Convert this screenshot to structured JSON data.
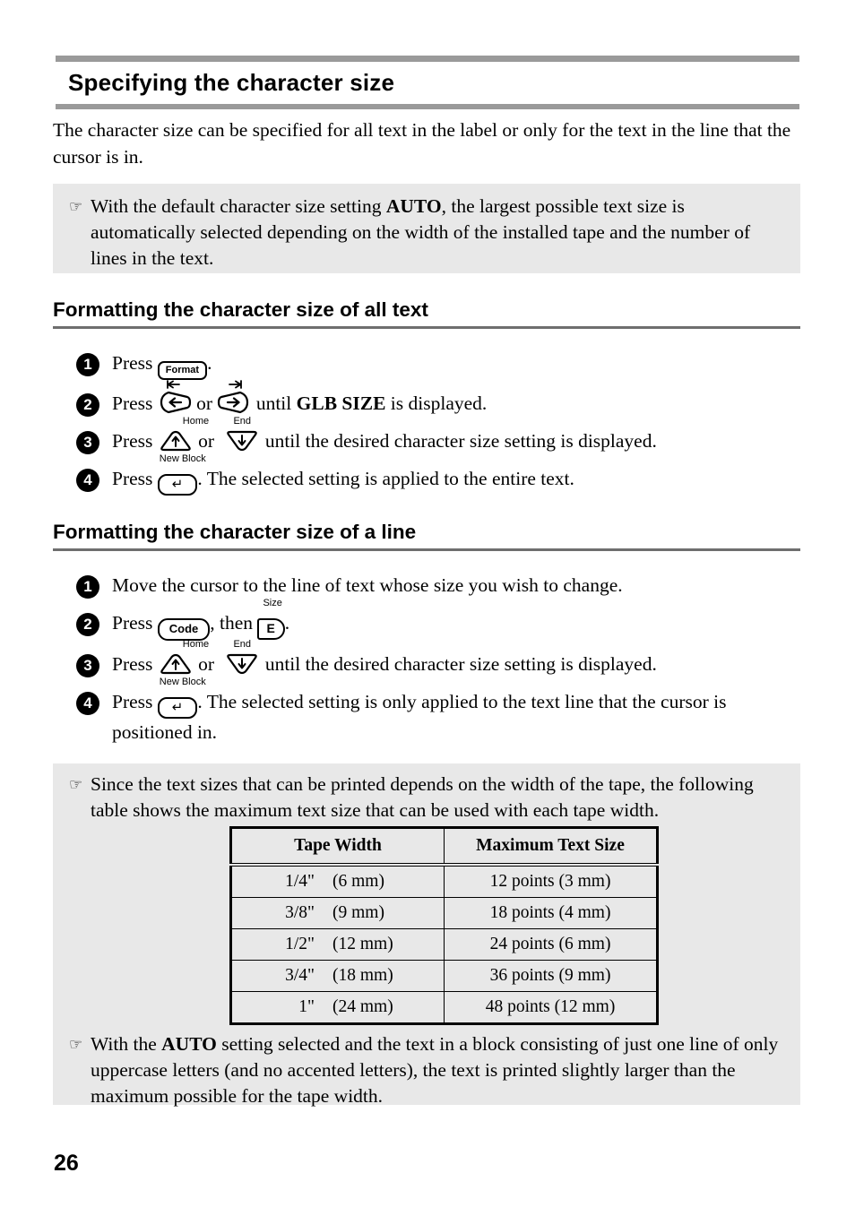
{
  "page": {
    "title": "Specifying the character size",
    "number": "26",
    "intro": "The character size can be specified for all text in the label or only for the text in the line that the cursor is in."
  },
  "note_top": {
    "icon": "pointing-hand-icon",
    "text_before": "With the default character size setting ",
    "emphasis": "AUTO",
    "text_after": ", the largest possible text size is automatically selected depending on the width of the installed tape and the number of lines in the text."
  },
  "section_all_text": {
    "heading": "Formatting the character size of all text",
    "steps": [
      {
        "num": "1",
        "before": "Press ",
        "key": {
          "label": "Format",
          "sub": "",
          "type": "rect"
        },
        "after": "."
      },
      {
        "num": "2",
        "before": "Press ",
        "key": {
          "label": "left-arrow",
          "sub": "",
          "type": "arrow-left"
        },
        "middle": " or ",
        "key2": {
          "label": "right-arrow",
          "sub": "",
          "type": "arrow-right"
        },
        "after": " until ",
        "emphasis": "GLB SIZE",
        "tail": " is displayed."
      },
      {
        "num": "3",
        "before": "Press ",
        "key": {
          "label": "up-arrow",
          "sub": "Home",
          "type": "arrow-up"
        },
        "middle": " or ",
        "key2": {
          "label": "down-arrow",
          "sub": "End",
          "type": "arrow-down"
        },
        "after": " until the desired character size setting is displayed."
      },
      {
        "num": "4",
        "before": "Press ",
        "key": {
          "label": "↵",
          "sub": "New Block",
          "type": "rect"
        },
        "after": ". The selected setting is applied to the entire text."
      }
    ]
  },
  "section_a_line": {
    "heading": "Formatting the character size of a line",
    "steps": [
      {
        "num": "1",
        "text": "Move the cursor to the line of text whose size you wish to change."
      },
      {
        "num": "2",
        "before": "Press ",
        "key": {
          "label": "Code",
          "sub": "",
          "type": "rect"
        },
        "middle": ", then ",
        "key2": {
          "label": "E",
          "sub": "Size",
          "type": "rect-e"
        },
        "after": "."
      },
      {
        "num": "3",
        "before": "Press ",
        "key": {
          "label": "up-arrow",
          "sub": "Home",
          "type": "arrow-up"
        },
        "middle": " or ",
        "key2": {
          "label": "down-arrow",
          "sub": "End",
          "type": "arrow-down"
        },
        "after": " until the desired character size setting is displayed."
      },
      {
        "num": "4",
        "before": "Press ",
        "key": {
          "label": "↵",
          "sub": "New Block",
          "type": "rect"
        },
        "after": ". The selected setting is only applied to the text line that the cursor is positioned in."
      }
    ]
  },
  "note_bottom": {
    "icon": "pointing-hand-icon",
    "line1": "Since the text sizes that can be printed depends on the width of the tape, the following table shows the maximum text size that can be used with each tape width.",
    "table": {
      "headers": [
        "Tape Width",
        "Maximum Text Size"
      ],
      "rows": [
        {
          "frac": "1/4\"",
          "mm": "(6 mm)",
          "max": "12 points (3 mm)"
        },
        {
          "frac": "3/8\"",
          "mm": "(9 mm)",
          "max": "18 points (4 mm)"
        },
        {
          "frac": "1/2\"",
          "mm": "(12 mm)",
          "max": "24 points (6 mm)"
        },
        {
          "frac": "3/4\"",
          "mm": "(18 mm)",
          "max": "36 points (9 mm)"
        },
        {
          "frac": "1\"",
          "mm": "(24 mm)",
          "max": "48 points (12 mm)"
        }
      ]
    },
    "note2_before": "With the ",
    "note2_emphasis": "AUTO",
    "note2_after": " setting selected and the text in a block consisting of just one line of only uppercase letters (and no accented letters), the text is printed slightly larger than the maximum possible for the tape width."
  },
  "colors": {
    "title_rule": "#9a9a9a",
    "section_rule": "#6e6e6e",
    "note_bg": "#e8e8e8",
    "text": "#000000"
  }
}
